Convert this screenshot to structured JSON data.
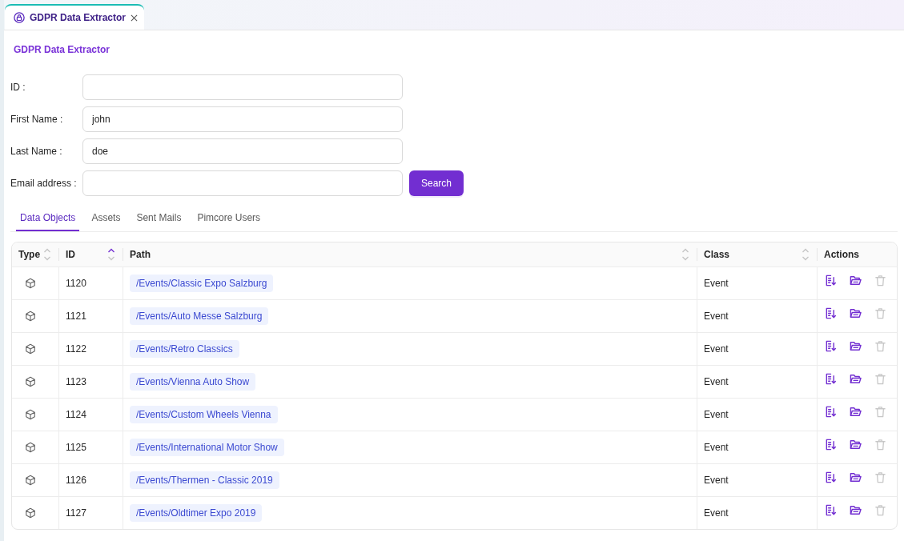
{
  "tabs": [
    {
      "label": "GDPR Data Extractor",
      "selected": true
    }
  ],
  "page_title": "GDPR Data Extractor",
  "form": {
    "fields": [
      {
        "label": "ID :"
      },
      {
        "label": "First Name :",
        "value": "john"
      },
      {
        "label": "Last Name :",
        "value": "doe"
      },
      {
        "label": "Email address :"
      }
    ],
    "search_button": "Search"
  },
  "result_tabs": [
    {
      "label": "Data Objects",
      "selected": true
    },
    {
      "label": "Assets",
      "selected": false
    },
    {
      "label": "Sent Mails",
      "selected": false
    },
    {
      "label": "Pimcore Users",
      "selected": false
    }
  ],
  "table": {
    "columns": [
      {
        "label": "Type",
        "sort_ascending": false
      },
      {
        "label": "ID",
        "sort_ascending": true
      },
      {
        "label": "Path",
        "sort_ascending": false
      },
      {
        "label": "Class",
        "sort_ascending": false
      },
      {
        "label": "Actions"
      }
    ],
    "rows": [
      {
        "id": "1120",
        "path": "/Events/Classic Expo Salzburg",
        "class": "Event",
        "actions": [
          {
            "kind": "export",
            "disabled": false
          },
          {
            "kind": "open",
            "disabled": false
          },
          {
            "kind": "delete",
            "disabled": true
          }
        ]
      },
      {
        "id": "1121",
        "path": "/Events/Auto Messe Salzburg",
        "class": "Event",
        "actions": [
          {
            "kind": "export",
            "disabled": false
          },
          {
            "kind": "open",
            "disabled": false
          },
          {
            "kind": "delete",
            "disabled": true
          }
        ]
      },
      {
        "id": "1122",
        "path": "/Events/Retro Classics",
        "class": "Event",
        "actions": [
          {
            "kind": "export",
            "disabled": false
          },
          {
            "kind": "open",
            "disabled": false
          },
          {
            "kind": "delete",
            "disabled": true
          }
        ]
      },
      {
        "id": "1123",
        "path": "/Events/Vienna Auto Show",
        "class": "Event",
        "actions": [
          {
            "kind": "export",
            "disabled": false
          },
          {
            "kind": "open",
            "disabled": false
          },
          {
            "kind": "delete",
            "disabled": true
          }
        ]
      },
      {
        "id": "1124",
        "path": "/Events/Custom Wheels Vienna",
        "class": "Event",
        "actions": [
          {
            "kind": "export",
            "disabled": false
          },
          {
            "kind": "open",
            "disabled": false
          },
          {
            "kind": "delete",
            "disabled": true
          }
        ]
      },
      {
        "id": "1125",
        "path": "/Events/International Motor Show",
        "class": "Event",
        "actions": [
          {
            "kind": "export",
            "disabled": false
          },
          {
            "kind": "open",
            "disabled": false
          },
          {
            "kind": "delete",
            "disabled": true
          }
        ]
      },
      {
        "id": "1126",
        "path": "/Events/Thermen - Classic 2019",
        "class": "Event",
        "actions": [
          {
            "kind": "export",
            "disabled": false
          },
          {
            "kind": "open",
            "disabled": false
          },
          {
            "kind": "delete",
            "disabled": true
          }
        ]
      },
      {
        "id": "1127",
        "path": "/Events/Oldtimer Expo 2019",
        "class": "Event",
        "actions": [
          {
            "kind": "export",
            "disabled": false
          },
          {
            "kind": "open",
            "disabled": false
          },
          {
            "kind": "delete",
            "disabled": true
          }
        ]
      }
    ]
  }
}
